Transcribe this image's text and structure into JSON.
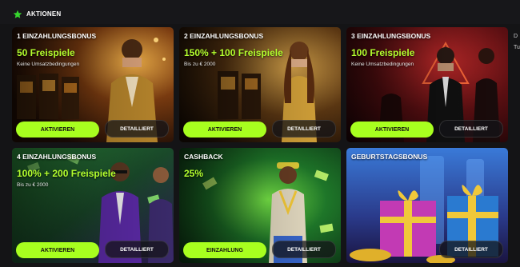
{
  "header": {
    "title": "AKTIONEN",
    "icon": "star-icon",
    "accent": "#36d62e"
  },
  "side_peek": [
    "D",
    "Tu"
  ],
  "cards": [
    {
      "title": "1 EINZAHLUNGSBONUS",
      "offer": "50 Freispiele",
      "sub": "Keine Umsatzbedingungen",
      "primary": "AKTIVIEREN",
      "secondary": "DETAILLIERT"
    },
    {
      "title": "2 EINZAHLUNGSBONUS",
      "offer": "150% + 100 Freispiele",
      "sub": "Bis zu € 2000",
      "primary": "AKTIVIEREN",
      "secondary": "DETAILLIERT"
    },
    {
      "title": "3 EINZAHLUNGSBONUS",
      "offer": "100 Freispiele",
      "sub": "Keine Umsatzbedingungen",
      "primary": "AKTIVIEREN",
      "secondary": "DETAILLIERT"
    },
    {
      "title": "4 EINZAHLUNGSBONUS",
      "offer": "100% + 200 Freispiele",
      "sub": "Bis zu € 2000",
      "primary": "AKTIVIEREN",
      "secondary": "DETAILLIERT"
    },
    {
      "title": "CASHBACK",
      "offer": "25%",
      "sub": "",
      "primary": "EINZAHLUNG",
      "secondary": "DETAILLIERT"
    },
    {
      "title": "GEBURTSTAGSBONUS",
      "offer": "",
      "sub": "",
      "primary": "",
      "secondary": "DETAILLIERT"
    }
  ],
  "colors": {
    "button_primary": "#a8ff1f",
    "offer_text": "#b4ff2e"
  }
}
